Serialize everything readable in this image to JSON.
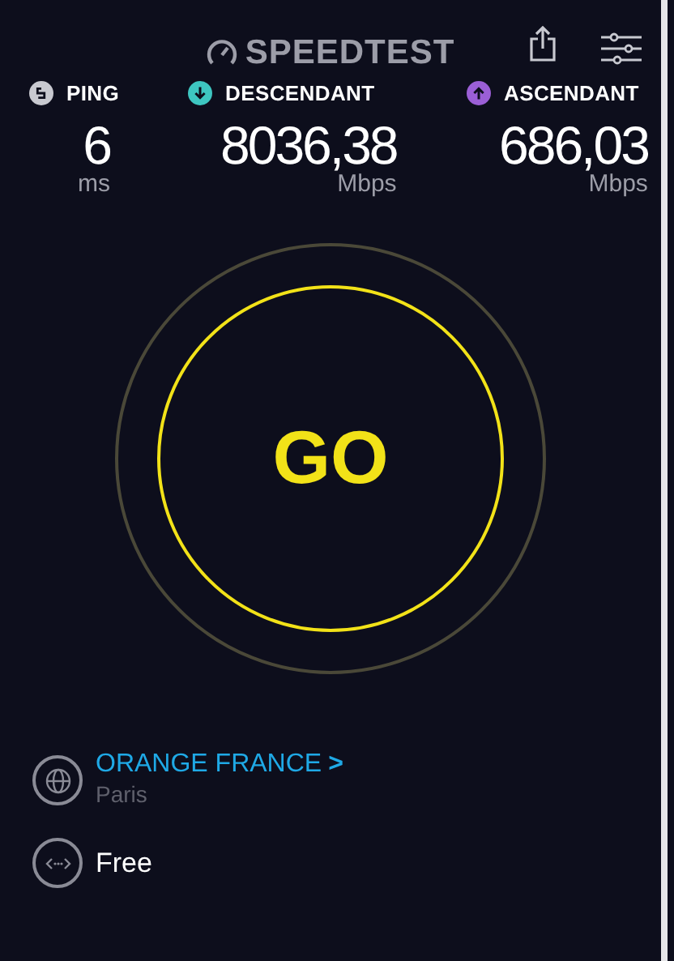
{
  "header": {
    "logo": "SPEEDTEST"
  },
  "metrics": [
    {
      "kind": "ping",
      "label": "PING",
      "value": "6",
      "unit": "ms"
    },
    {
      "kind": "download",
      "label": "DESCENDANT",
      "value": "8036,38",
      "unit": "Mbps"
    },
    {
      "kind": "upload",
      "label": "ASCENDANT",
      "value": "686,03",
      "unit": "Mbps"
    }
  ],
  "go_button": {
    "label": "GO"
  },
  "server": {
    "provider": "ORANGE FRANCE",
    "chevron": ">",
    "location": "Paris"
  },
  "connection": {
    "name": "Free"
  }
}
